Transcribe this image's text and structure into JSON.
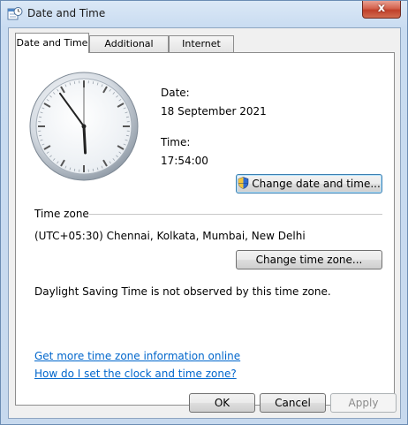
{
  "window": {
    "title": "Date and Time",
    "close_label": "x"
  },
  "tabs": [
    {
      "label": "Date and Time",
      "active": true
    },
    {
      "label": "Additional Clocks",
      "active": false
    },
    {
      "label": "Internet Time",
      "active": false
    }
  ],
  "date": {
    "label": "Date:",
    "value": "18 September 2021"
  },
  "time": {
    "label": "Time:",
    "value": "17:54:00"
  },
  "clock": {
    "hours": 17,
    "minutes": 54,
    "seconds": 0
  },
  "buttons": {
    "change_date_time": "Change date and time...",
    "change_time_zone": "Change time zone...",
    "ok": "OK",
    "cancel": "Cancel",
    "apply": "Apply"
  },
  "time_zone": {
    "heading": "Time zone",
    "value": "(UTC+05:30) Chennai, Kolkata, Mumbai, New Delhi",
    "dst_note": "Daylight Saving Time is not observed by this time zone."
  },
  "links": {
    "more_info": "Get more time zone information online",
    "how_to": "How do I set the clock and time zone?"
  },
  "colors": {
    "link": "#0066cc",
    "close": "#c7432c",
    "accent": "#3c7fb1"
  }
}
